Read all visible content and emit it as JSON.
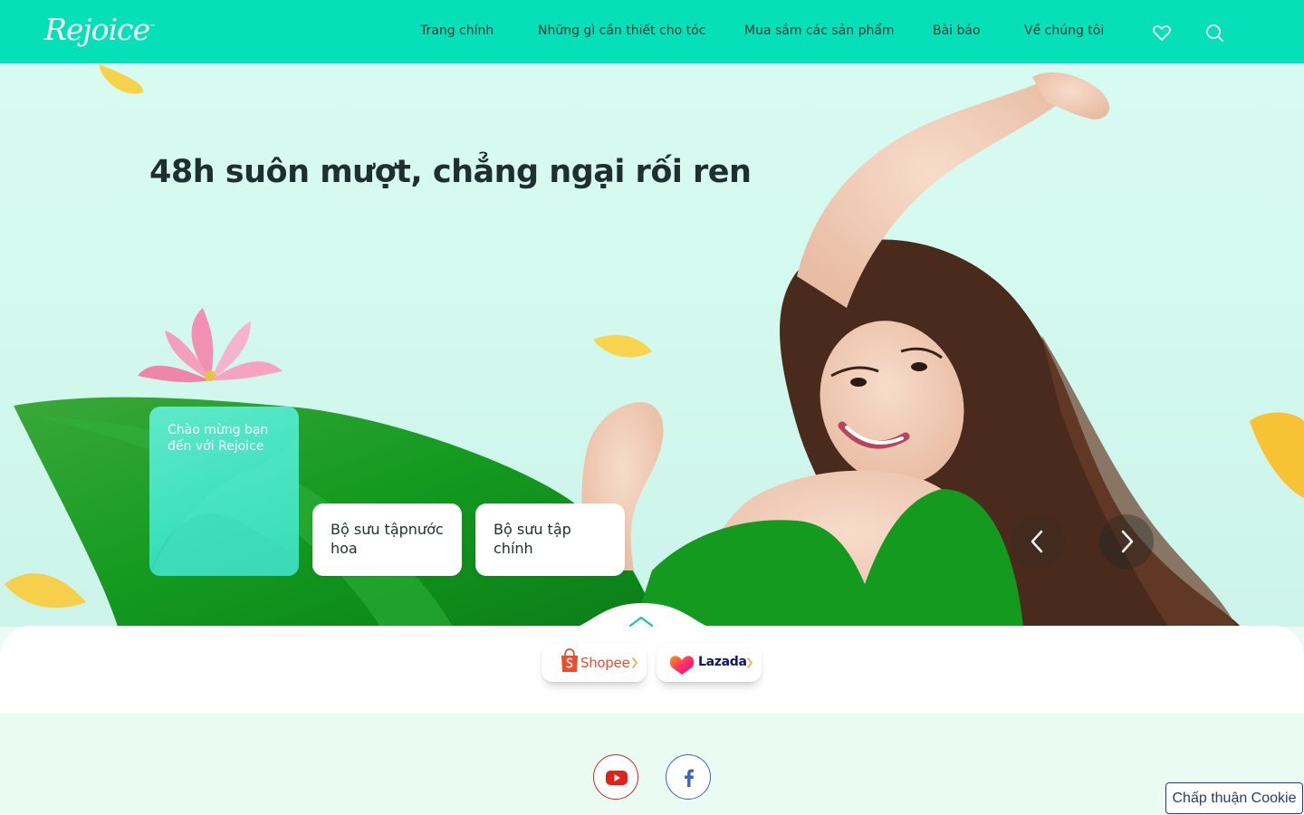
{
  "header": {
    "logo_text": "Rejoice",
    "logo_mark": "™",
    "nav": [
      {
        "label": "Trang chính"
      },
      {
        "label": "Những gì cần thiết cho tóc"
      },
      {
        "label": "Mua sắm các sản phẩm"
      },
      {
        "label": "Bài báo"
      },
      {
        "label": "Về chúng tôi"
      }
    ],
    "icons": [
      "heart-icon",
      "search-icon"
    ]
  },
  "hero": {
    "headline": "48h suôn mượt, chẳng ngại rối ren",
    "cards": [
      {
        "label": "Chào mừng bạn đến với Rejoice",
        "active": true
      },
      {
        "label": "Bộ sưu tậpnước hoa",
        "active": false
      },
      {
        "label": "Bộ sưu tập chính",
        "active": false
      }
    ]
  },
  "shop": {
    "buttons": [
      {
        "label": "Shopee",
        "icon": "shopee-bag-icon",
        "color": "#ee4d2d"
      },
      {
        "label": "Lazada",
        "icon": "lazada-heart-icon",
        "color": "#0f146d"
      }
    ]
  },
  "footer": {
    "social": [
      {
        "name": "YouTube",
        "icon": "youtube-icon",
        "color": "#e0221b"
      },
      {
        "name": "Facebook",
        "icon": "facebook-icon",
        "color": "#3b64b5"
      }
    ]
  },
  "cookie": {
    "label": "Chấp thuận Cookie"
  },
  "colors": {
    "brand": "#05e0b8",
    "hero_bg": "#d8fbf1",
    "card_active": "#3ce0bd",
    "text_dark": "#1f2e2f"
  }
}
